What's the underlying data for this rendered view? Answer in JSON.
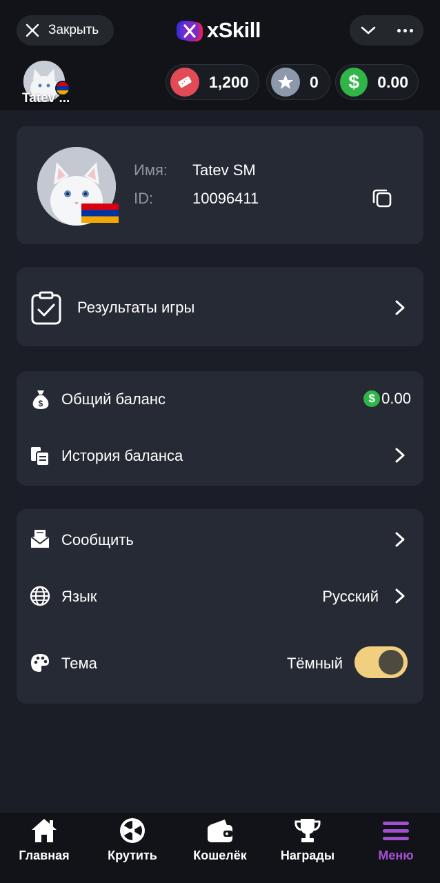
{
  "header": {
    "close_label": "Закрыть",
    "logo_text": "xSkill",
    "user_short_name": "Tatev ..."
  },
  "balances": {
    "tickets": "1,200",
    "stars": "0",
    "cash": "0.00"
  },
  "profile": {
    "name_label": "Имя:",
    "name_value": "Tatev SM",
    "id_label": "ID:",
    "id_value": "10096411"
  },
  "menu": {
    "game_results": "Результаты игры",
    "total_balance_label": "Общий баланс",
    "total_balance_value": "0.00",
    "balance_history": "История баланса",
    "report": "Сообщить",
    "language_label": "Язык",
    "language_value": "Русский",
    "theme_label": "Тема",
    "theme_value": "Тёмный"
  },
  "nav": {
    "items": [
      {
        "label": "Главная",
        "icon": "home-icon"
      },
      {
        "label": "Крутить",
        "icon": "wheel-icon"
      },
      {
        "label": "Кошелёк",
        "icon": "wallet-icon"
      },
      {
        "label": "Награды",
        "icon": "trophy-icon"
      },
      {
        "label": "Меню",
        "icon": "menu-icon"
      }
    ],
    "active_index": 4
  },
  "colors": {
    "accent_active": "#a34fd1",
    "toggle_on": "#f2cf7e",
    "cash_green": "#2fb548",
    "ticket_red": "#e24a55"
  }
}
